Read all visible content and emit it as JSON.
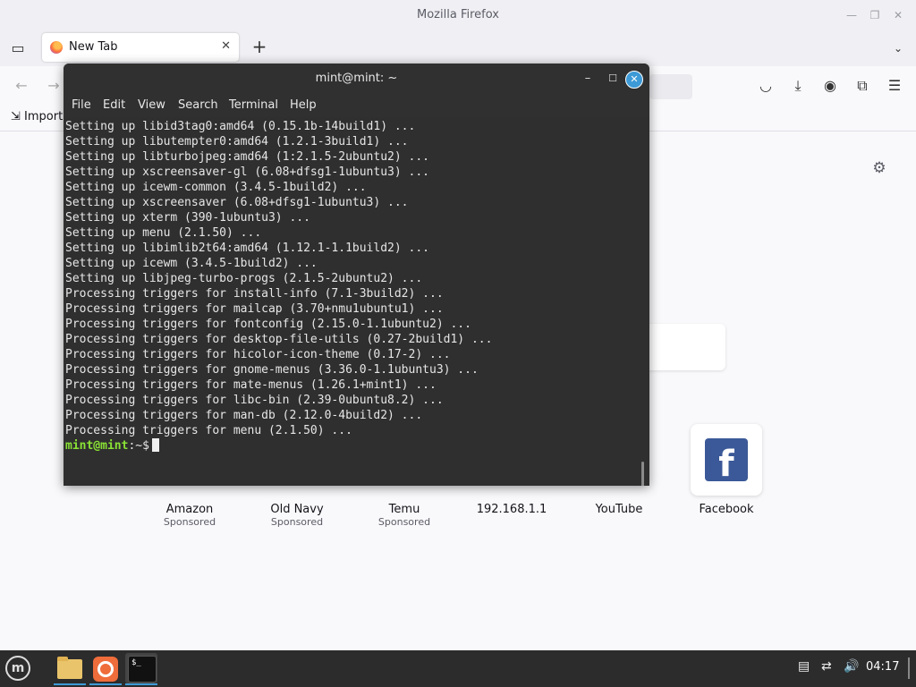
{
  "firefox": {
    "window_title": "Mozilla Firefox",
    "tab_label": "New Tab",
    "tab_close": "✕",
    "new_tab": "+",
    "bookmark_import": "Import",
    "tiles": [
      {
        "label": "Amazon",
        "sub": "Sponsored"
      },
      {
        "label": "Old Navy",
        "sub": "Sponsored"
      },
      {
        "label": "Temu",
        "sub": "Sponsored"
      },
      {
        "label": "192.168.1.1",
        "sub": ""
      },
      {
        "label": "YouTube",
        "sub": ""
      },
      {
        "label": "Facebook",
        "sub": ""
      }
    ]
  },
  "terminal": {
    "title": "mint@mint: ~",
    "menu": [
      "File",
      "Edit",
      "View",
      "Search",
      "Terminal",
      "Help"
    ],
    "lines": [
      "Setting up libid3tag0:amd64 (0.15.1b-14build1) ...",
      "Setting up libutempter0:amd64 (1.2.1-3build1) ...",
      "Setting up libturbojpeg:amd64 (1:2.1.5-2ubuntu2) ...",
      "Setting up xscreensaver-gl (6.08+dfsg1-1ubuntu3) ...",
      "Setting up icewm-common (3.4.5-1build2) ...",
      "Setting up xscreensaver (6.08+dfsg1-1ubuntu3) ...",
      "Setting up xterm (390-1ubuntu3) ...",
      "Setting up menu (2.1.50) ...",
      "Setting up libimlib2t64:amd64 (1.12.1-1.1build2) ...",
      "Setting up icewm (3.4.5-1build2) ...",
      "Setting up libjpeg-turbo-progs (2.1.5-2ubuntu2) ...",
      "Processing triggers for install-info (7.1-3build2) ...",
      "Processing triggers for mailcap (3.70+nmu1ubuntu1) ...",
      "Processing triggers for fontconfig (2.15.0-1.1ubuntu2) ...",
      "Processing triggers for desktop-file-utils (0.27-2build1) ...",
      "Processing triggers for hicolor-icon-theme (0.17-2) ...",
      "Processing triggers for gnome-menus (3.36.0-1.1ubuntu3) ...",
      "Processing triggers for mate-menus (1.26.1+mint1) ...",
      "Processing triggers for libc-bin (2.39-0ubuntu8.2) ...",
      "Processing triggers for man-db (2.12.0-4build2) ...",
      "Processing triggers for menu (2.1.50) ..."
    ],
    "prompt_user": "mint@mint",
    "prompt_path": ":~$"
  },
  "taskbar": {
    "clock": "04:17"
  },
  "icons": [
    "back-icon",
    "forward-icon",
    "pocket-icon",
    "download-icon",
    "account-icon",
    "extensions-icon",
    "hamburger-menu-icon",
    "gear-icon",
    "facebook-logo-icon",
    "linux-mint-menu-icon",
    "files-icon",
    "firefox-icon",
    "terminal-icon",
    "notes-tray-icon",
    "network-tray-icon",
    "volume-tray-icon"
  ]
}
